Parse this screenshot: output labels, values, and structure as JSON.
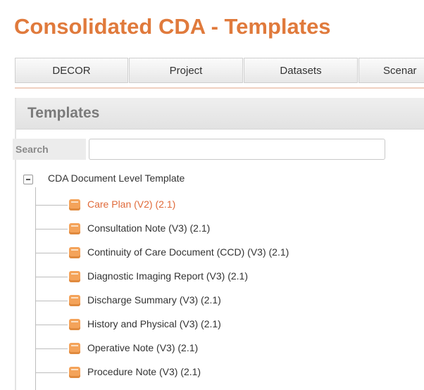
{
  "page": {
    "title": "Consolidated CDA - Templates"
  },
  "tabs": [
    "DECOR",
    "Project",
    "Datasets",
    "Scenar"
  ],
  "panel": {
    "title": "Templates",
    "search_label": "Search",
    "search_value": ""
  },
  "tree": {
    "root_label": "CDA Document Level Template",
    "items": [
      "Care Plan (V2) (2.1)",
      "Consultation Note (V3) (2.1)",
      "Continuity of Care Document (CCD) (V3) (2.1)",
      "Diagnostic Imaging Report (V3) (2.1)",
      "Discharge Summary (V3) (2.1)",
      "History and Physical (V3) (2.1)",
      "Operative Note (V3) (2.1)",
      "Procedure Note (V3) (2.1)"
    ]
  },
  "colors": {
    "accent": "#e07a3c",
    "selected_item": "#e06a3a",
    "icon": "#f4a35a"
  }
}
